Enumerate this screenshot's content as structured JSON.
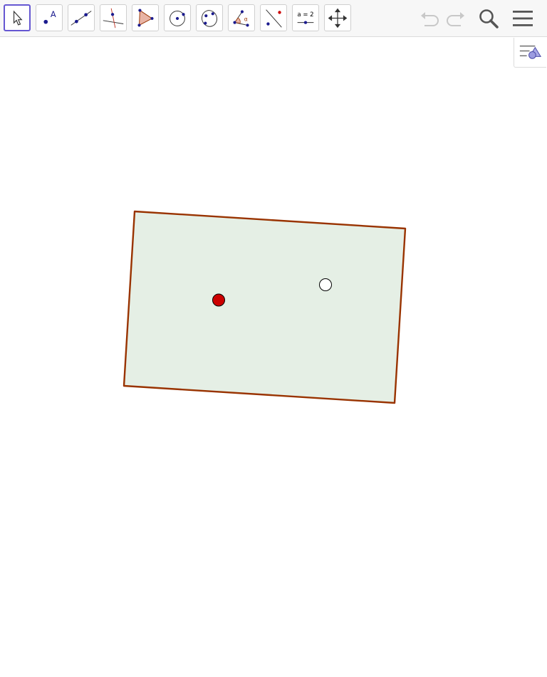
{
  "toolbar": {
    "tools": [
      {
        "name": "move-tool",
        "icon": "arrow-pointer-icon",
        "selected": true
      },
      {
        "name": "point-tool",
        "icon": "point-icon",
        "label": "A"
      },
      {
        "name": "line-tool",
        "icon": "line-through-points-icon"
      },
      {
        "name": "perpendicular-line-tool",
        "icon": "perpendicular-line-icon"
      },
      {
        "name": "polygon-tool",
        "icon": "polygon-icon"
      },
      {
        "name": "circle-tool",
        "icon": "circle-center-point-icon"
      },
      {
        "name": "ellipse-tool",
        "icon": "ellipse-icon"
      },
      {
        "name": "angle-tool",
        "icon": "angle-icon",
        "label": "α"
      },
      {
        "name": "reflect-tool",
        "icon": "reflect-about-line-icon"
      },
      {
        "name": "slider-tool",
        "icon": "slider-icon",
        "label": "a = 2"
      },
      {
        "name": "move-graphics-view-tool",
        "icon": "move-graphics-view-icon"
      }
    ],
    "actions": [
      "undo-icon",
      "redo-icon",
      "search-icon",
      "menu-icon"
    ]
  },
  "colors": {
    "selected_border": "#6557d2",
    "polygon_fill": "#e5efe5",
    "polygon_stroke": "#993300",
    "point_red": "#cc0000",
    "point_blue": "#1b1b8e"
  }
}
